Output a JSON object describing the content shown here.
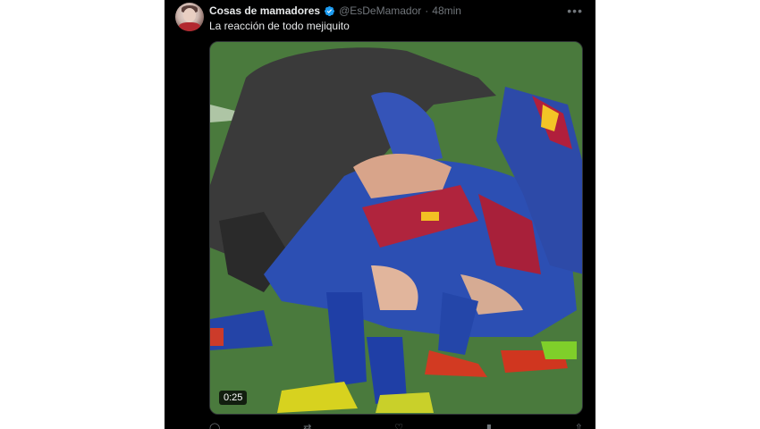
{
  "tweet": {
    "author_name": "Cosas de mamadores",
    "handle": "@EsDeMamador",
    "separator": "·",
    "timestamp": "48min",
    "text": "La reacción de todo mejiquito",
    "more_icon": "more-horizontal-icon"
  },
  "media": {
    "duration": "0:25",
    "type": "video"
  },
  "colors": {
    "background": "#000000",
    "text_primary": "#e7e9ea",
    "text_secondary": "#71767b",
    "verified": "#1d9bf0"
  }
}
